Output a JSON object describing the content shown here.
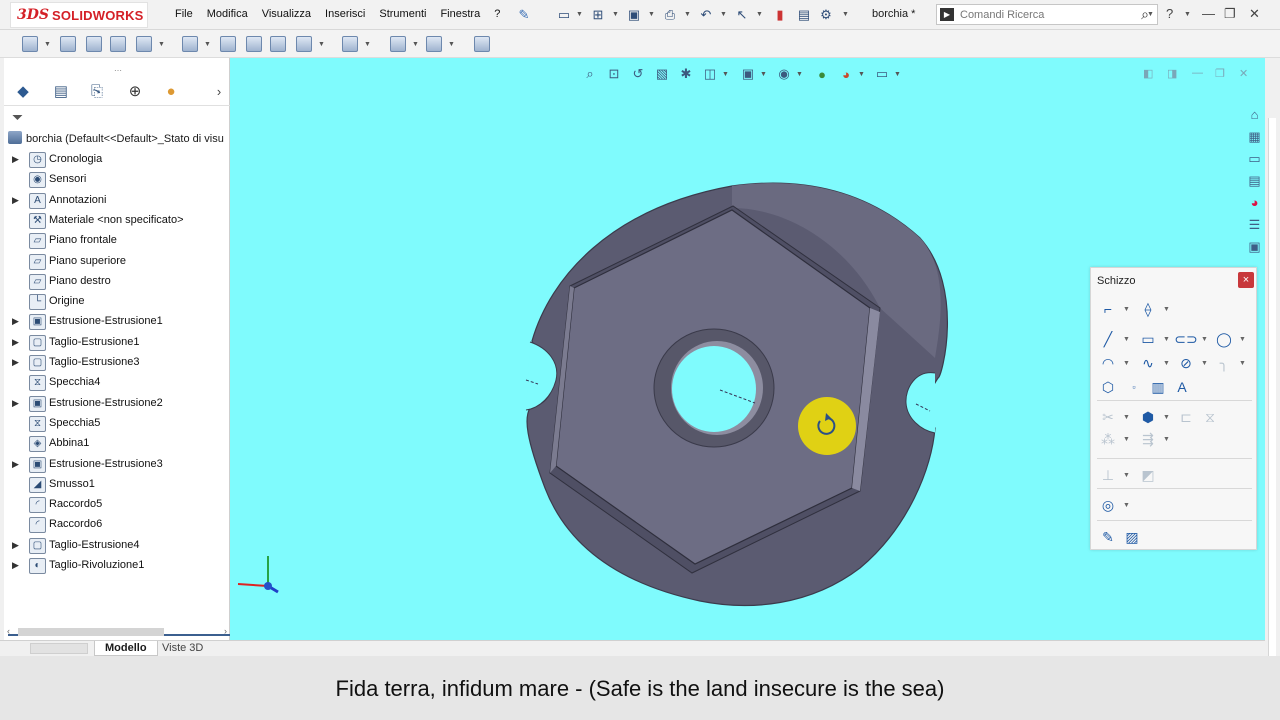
{
  "app": {
    "logo_text": "SOLIDWORKS",
    "logo_prefix": "3DS",
    "document_name": "borchia *"
  },
  "menu": [
    "File",
    "Modifica",
    "Visualizza",
    "Inserisci",
    "Strumenti",
    "Finestra",
    "?"
  ],
  "search": {
    "placeholder": "Comandi Ricerca"
  },
  "feature_tree": {
    "root": "borchia  (Default<<Default>_Stato di visu",
    "items": [
      {
        "label": "Cronologia",
        "expandable": true,
        "icon": "history-icon"
      },
      {
        "label": "Sensori",
        "expandable": false,
        "icon": "sensor-icon"
      },
      {
        "label": "Annotazioni",
        "expandable": true,
        "icon": "annotation-icon"
      },
      {
        "label": "Materiale <non specificato>",
        "expandable": false,
        "icon": "material-icon"
      },
      {
        "label": "Piano frontale",
        "expandable": false,
        "icon": "plane-icon"
      },
      {
        "label": "Piano superiore",
        "expandable": false,
        "icon": "plane-icon"
      },
      {
        "label": "Piano destro",
        "expandable": false,
        "icon": "plane-icon"
      },
      {
        "label": "Origine",
        "expandable": false,
        "icon": "origin-icon"
      },
      {
        "label": "Estrusione-Estrusione1",
        "expandable": true,
        "icon": "extrude-icon"
      },
      {
        "label": "Taglio-Estrusione1",
        "expandable": true,
        "icon": "cut-extrude-icon"
      },
      {
        "label": "Taglio-Estrusione3",
        "expandable": true,
        "icon": "cut-extrude-icon"
      },
      {
        "label": "Specchia4",
        "expandable": false,
        "icon": "mirror-icon"
      },
      {
        "label": "Estrusione-Estrusione2",
        "expandable": true,
        "icon": "extrude-icon"
      },
      {
        "label": "Specchia5",
        "expandable": false,
        "icon": "mirror-icon"
      },
      {
        "label": "Abbina1",
        "expandable": false,
        "icon": "combine-icon"
      },
      {
        "label": "Estrusione-Estrusione3",
        "expandable": true,
        "icon": "extrude-icon"
      },
      {
        "label": "Smusso1",
        "expandable": false,
        "icon": "chamfer-icon"
      },
      {
        "label": "Raccordo5",
        "expandable": false,
        "icon": "fillet-icon"
      },
      {
        "label": "Raccordo6",
        "expandable": false,
        "icon": "fillet-icon"
      },
      {
        "label": "Taglio-Estrusione4",
        "expandable": true,
        "icon": "cut-extrude-icon"
      },
      {
        "label": "Taglio-Rivoluzione1",
        "expandable": true,
        "icon": "cut-revolve-icon"
      }
    ]
  },
  "bottom_tabs": {
    "model": "Modello",
    "views3d": "Viste 3D"
  },
  "sketch_palette": {
    "title": "Schizzo",
    "close": "×"
  },
  "caption": "Fida terra, infidum mare - (Safe is the land insecure is the sea)",
  "colors": {
    "viewport_bg": "#7ffbfd",
    "part_face": "#6c6c80",
    "part_top": "#62627a",
    "accent_red": "#d42027",
    "cursor_yellow": "#f4e300"
  }
}
